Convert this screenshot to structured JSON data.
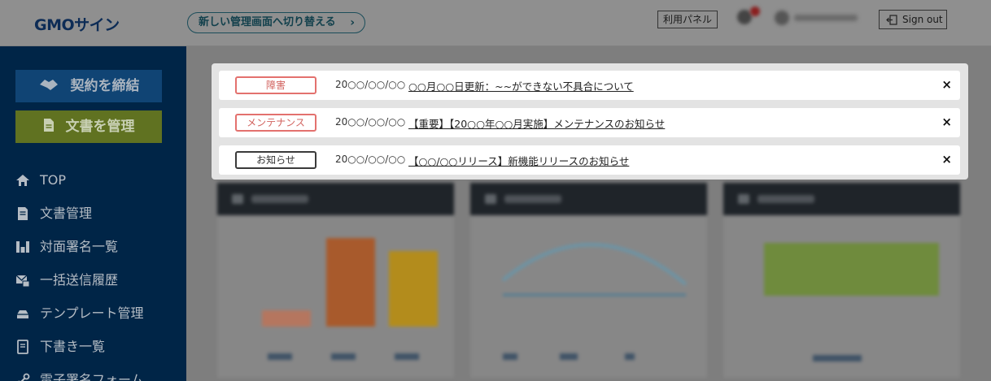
{
  "header": {
    "logo": "GMOサイン",
    "switch_button": "新しい管理画面へ切り替える",
    "switch_chevron": "›",
    "usage_panel": "利用パネル",
    "sign_out": "Sign out"
  },
  "sidebar": {
    "contract_button": "契約を締結",
    "docs_button": "文書を管理",
    "items": [
      {
        "label": "TOP",
        "icon": "home-icon"
      },
      {
        "label": "文書管理",
        "icon": "document-icon"
      },
      {
        "label": "対面署名一覧",
        "icon": "face-to-face-icon"
      },
      {
        "label": "一括送信履歴",
        "icon": "bulk-send-icon"
      },
      {
        "label": "テンプレート管理",
        "icon": "template-icon"
      },
      {
        "label": "下書き一覧",
        "icon": "draft-icon"
      },
      {
        "label": "電子署名フォーム",
        "icon": "form-icon"
      }
    ]
  },
  "notifications": [
    {
      "category": "障害",
      "style": "red",
      "date": "20○○/○○/○○",
      "title": "○○月○○日更新：~~ができない不具合について",
      "close": "×"
    },
    {
      "category": "メンテナンス",
      "style": "red",
      "date": "20○○/○○/○○",
      "title": "【重要】【20○○年○○月実施】メンテナンスのお知らせ",
      "close": "×"
    },
    {
      "category": "お知らせ",
      "style": "gray",
      "date": "20○○/○○/○○",
      "title": "【○○/○○リリース】新機能リリースのお知らせ",
      "close": "×"
    }
  ],
  "colors": {
    "accent_red": "#e3716e",
    "sidebar_bg": "#002547",
    "contract_btn": "#104474",
    "docs_btn": "#607221"
  }
}
